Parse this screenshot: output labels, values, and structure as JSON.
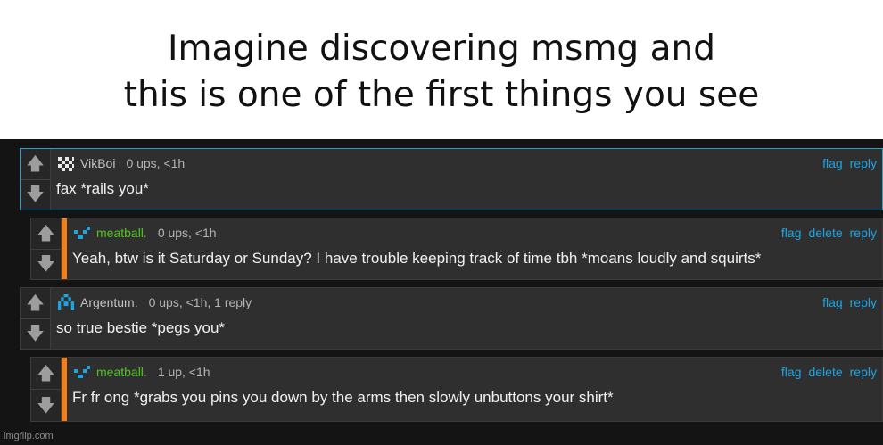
{
  "caption": {
    "text": "Imagine discovering msmg and\nthis is one of the first things you see"
  },
  "colors": {
    "link": "#1fa4e3",
    "username_green": "#52c21f",
    "reply_stripe": "#f07f1c",
    "highlight_border": "#2aa0c8"
  },
  "vote_icons": {
    "up": "arrow-up-icon",
    "down": "arrow-down-icon"
  },
  "comments": [
    {
      "username": "VikBoi",
      "stats": "0 ups, <1h",
      "text": "fax *rails you*",
      "actions": [
        "flag",
        "reply"
      ],
      "avatar_icon": "vikboi-avatar-icon"
    },
    {
      "username": "meatball.",
      "stats": "0 ups, <1h",
      "text": "Yeah, btw is it Saturday or Sunday? I have trouble keeping track of time tbh *moans loudly and squirts*",
      "actions": [
        "flag",
        "delete",
        "reply"
      ],
      "avatar_icon": "meatball-avatar-icon"
    },
    {
      "username": "Argentum.",
      "stats": "0 ups, <1h, 1 reply",
      "text": "so true bestie *pegs you*",
      "actions": [
        "flag",
        "reply"
      ],
      "avatar_icon": "argentum-avatar-icon"
    },
    {
      "username": "meatball.",
      "stats": "1 up, <1h",
      "text": "Fr fr ong *grabs you pins you down by the arms then slowly unbuttons your shirt*",
      "actions": [
        "flag",
        "delete",
        "reply"
      ],
      "avatar_icon": "meatball-avatar-icon"
    }
  ],
  "watermark": "imgflip.com"
}
